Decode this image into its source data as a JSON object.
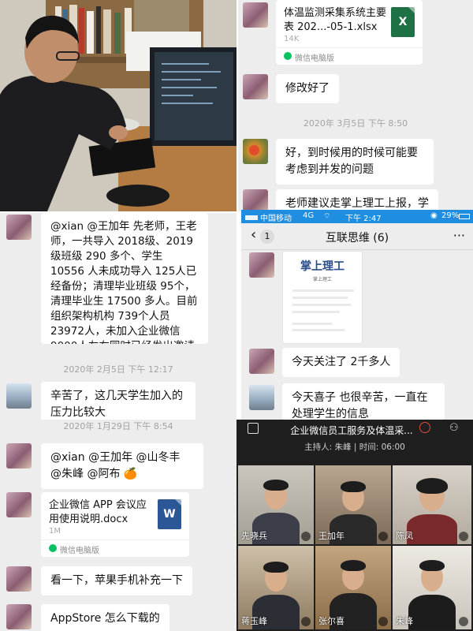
{
  "top_left": {
    "description_icon": "photo-icon"
  },
  "top_right": {
    "file1": {
      "name": "体温监测采集系统主要表 202...-05-1.xlsx",
      "size": "14K",
      "source": "微信电脑版",
      "icon_letter": "X",
      "icon_color": "#1e7145"
    },
    "msg1": "修改好了",
    "time1": "2020年 3月5日 下午 8:50",
    "msg2": "好，到时候用的时候可能要考虑到并发的问题",
    "msg3": "老师建议走掌上理工上报，学"
  },
  "middle_left": {
    "msg1": "@xian @王加年 先老师，王老师，一共导入 2018级、2019级班级 290 多个、学生 10556 人未成功导入 125人已经备份；清理毕业班级 95个，清理毕业生 17500 多人。目前组织架构机构 739个人员 23972人，未加入企业微信 9000人左右同时已经发出邀请加入",
    "time1": "2020年 2月5日 下午 12:17",
    "msg2": "辛苦了，这几天学生加入的压力比较大",
    "time2": "2020年 1月29日 下午 8:54"
  },
  "middle_right": {
    "status": {
      "carrier": "中国移动",
      "network": "4G",
      "time": "下午 2:47",
      "battery": "29%"
    },
    "nav": {
      "back_count": "1",
      "title": "互联思维 (6)",
      "more": "···"
    },
    "card": {
      "title": "掌上理工",
      "subtitle": "掌上理工"
    },
    "msg1": "今天关注了 2千多人",
    "msg2": "今天喜子 也很辛苦，一直在处理学生的信息"
  },
  "bottom_left": {
    "msg1": "@xian @王加年 @山冬丰 @朱峰 @阿布 🍊",
    "file1": {
      "name": "企业微信 APP 会议应用使用说明.docx",
      "size": "1M",
      "source": "微信电脑版",
      "icon_letter": "W",
      "icon_color": "#2b5797"
    },
    "msg2": "看一下，苹果手机补充一下",
    "msg3": "AppStore 怎么下载的"
  },
  "bottom_right": {
    "title": "企业微信员工服务及体温采...",
    "host": "主持人: 朱峰 | 时间: 06:00",
    "participants": [
      "先晓兵",
      "王加年",
      "陈凤",
      "蒋玉峰",
      "张尔喜",
      "朱峰"
    ]
  }
}
